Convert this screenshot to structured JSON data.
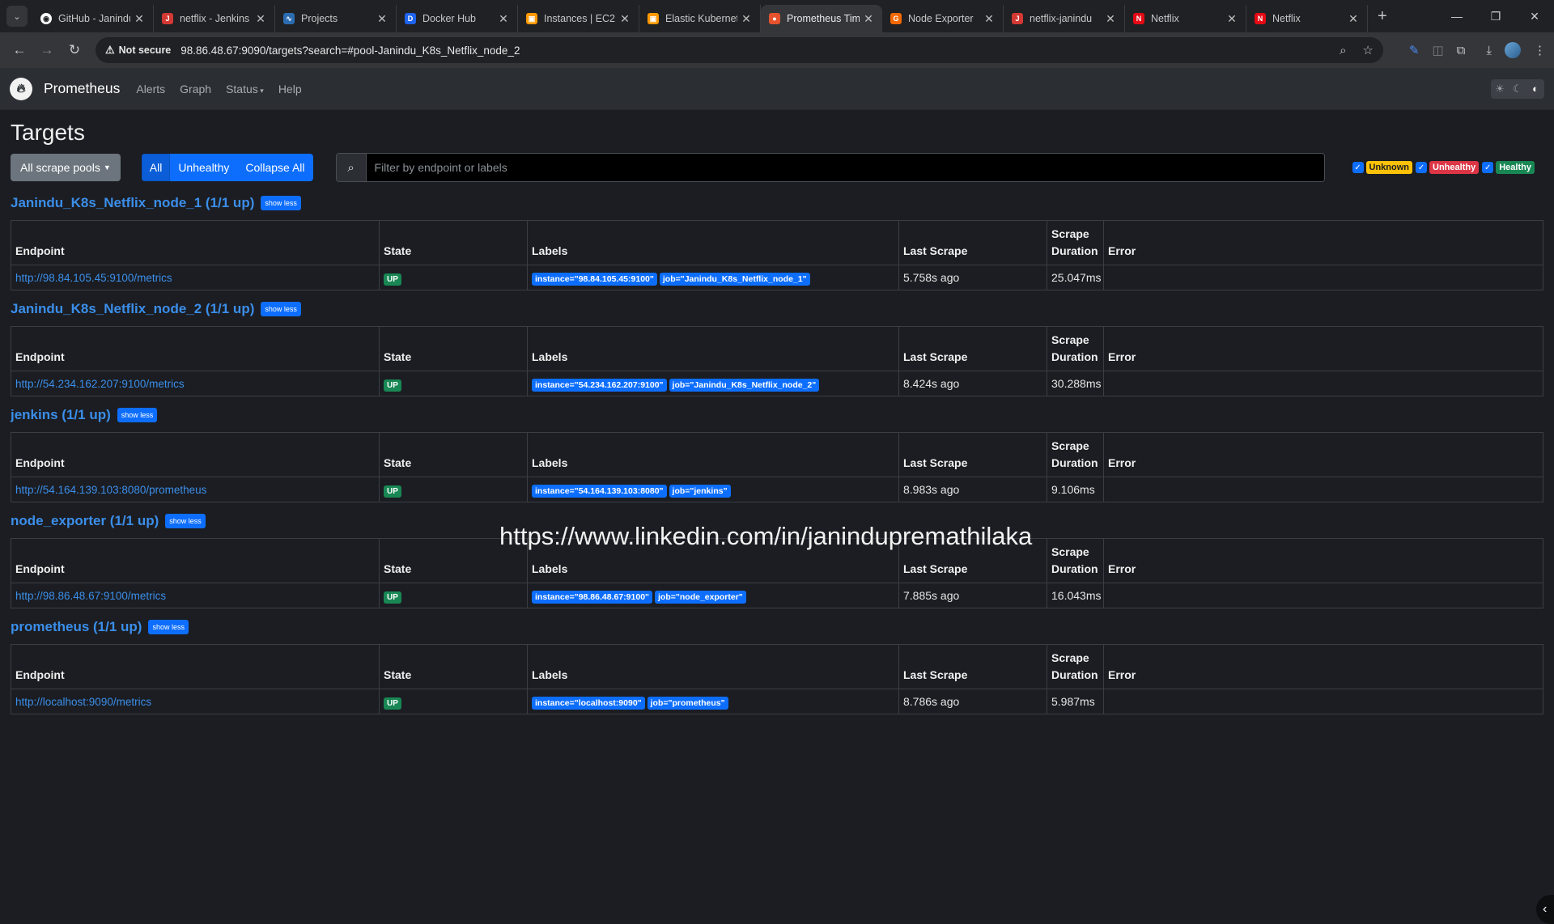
{
  "browser": {
    "tabs": [
      {
        "title": "GitHub - Janindu",
        "favicon_color": "#ffffff",
        "favicon_glyph": "◉",
        "active": false
      },
      {
        "title": "netflix - Jenkins",
        "favicon_color": "#d33833",
        "favicon_glyph": "J",
        "active": false
      },
      {
        "title": "Projects",
        "favicon_color": "#2b6cb0",
        "favicon_glyph": "∿",
        "active": false
      },
      {
        "title": "Docker Hub",
        "favicon_color": "#1d63ed",
        "favicon_glyph": "D",
        "active": false
      },
      {
        "title": "Instances | EC2",
        "favicon_color": "#ff9900",
        "favicon_glyph": "▣",
        "active": false
      },
      {
        "title": "Elastic Kubernetes",
        "favicon_color": "#ff9900",
        "favicon_glyph": "▣",
        "active": false
      },
      {
        "title": "Prometheus Time",
        "favicon_color": "#e6522c",
        "favicon_glyph": "●",
        "active": true
      },
      {
        "title": "Node Exporter",
        "favicon_color": "#f46800",
        "favicon_glyph": "G",
        "active": false
      },
      {
        "title": "netflix-janindu",
        "favicon_color": "#d33833",
        "favicon_glyph": "J",
        "active": false
      },
      {
        "title": "Netflix",
        "favicon_color": "#e50914",
        "favicon_glyph": "N",
        "active": false
      },
      {
        "title": "Netflix",
        "favicon_color": "#e50914",
        "favicon_glyph": "N",
        "active": false
      }
    ],
    "security_label": "Not secure",
    "url": "98.86.48.67:9090/targets?search=#pool-Janindu_K8s_Netflix_node_2"
  },
  "nav": {
    "brand": "Prometheus",
    "links": [
      "Alerts",
      "Graph",
      "Status",
      "Help"
    ]
  },
  "page": {
    "title": "Targets",
    "pools_button": "All scrape pools",
    "filter_buttons": [
      "All",
      "Unhealthy",
      "Collapse All"
    ],
    "search_placeholder": "Filter by endpoint or labels",
    "state_filters": [
      "Unknown",
      "Unhealthy",
      "Healthy"
    ],
    "columns": {
      "endpoint": "Endpoint",
      "state": "State",
      "labels": "Labels",
      "last_scrape": "Last Scrape",
      "scrape_duration_line1": "Scrape",
      "scrape_duration_line2": "Duration",
      "error": "Error"
    },
    "show_less": "show less",
    "watermark": "https://www.linkedin.com/in/janinduprem​athilaka"
  },
  "pools": [
    {
      "title": "Janindu_K8s_Netflix_node_1 (1/1 up)",
      "endpoint": "http://98.84.105.45:9100/metrics",
      "state": "UP",
      "labels": [
        "instance=\"98.84.105.45:9100\"",
        "job=\"Janindu_K8s_Netflix_node_1\""
      ],
      "last_scrape": "5.758s ago",
      "duration": "25.047ms",
      "error": ""
    },
    {
      "title": "Janindu_K8s_Netflix_node_2 (1/1 up)",
      "endpoint": "http://54.234.162.207:9100/metrics",
      "state": "UP",
      "labels": [
        "instance=\"54.234.162.207:9100\"",
        "job=\"Janindu_K8s_Netflix_node_2\""
      ],
      "last_scrape": "8.424s ago",
      "duration": "30.288ms",
      "error": ""
    },
    {
      "title": "jenkins (1/1 up)",
      "endpoint": "http://54.164.139.103:8080/prometheus",
      "state": "UP",
      "labels": [
        "instance=\"54.164.139.103:8080\"",
        "job=\"jenkins\""
      ],
      "last_scrape": "8.983s ago",
      "duration": "9.106ms",
      "error": ""
    },
    {
      "title": "node_exporter (1/1 up)",
      "endpoint": "http://98.86.48.67:9100/metrics",
      "state": "UP",
      "labels": [
        "instance=\"98.86.48.67:9100\"",
        "job=\"node_exporter\""
      ],
      "last_scrape": "7.885s ago",
      "duration": "16.043ms",
      "error": ""
    },
    {
      "title": "prometheus (1/1 up)",
      "endpoint": "http://localhost:9090/metrics",
      "state": "UP",
      "labels": [
        "instance=\"localhost:9090\"",
        "job=\"prometheus\""
      ],
      "last_scrape": "8.786s ago",
      "duration": "5.987ms",
      "error": ""
    }
  ]
}
